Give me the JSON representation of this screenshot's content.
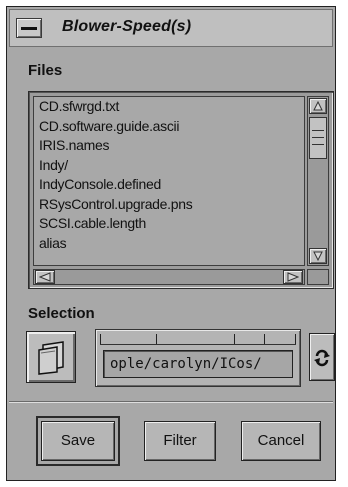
{
  "window": {
    "title": "Blower-Speed(s)"
  },
  "files": {
    "label": "Files",
    "items": [
      "CD.sfwrgd.txt",
      "CD.software.guide.ascii",
      "IRIS.names",
      "Indy/",
      "IndyConsole.defined",
      "RSysControl.upgrade.pns",
      "SCSI.cable.length",
      "alias"
    ]
  },
  "selection": {
    "label": "Selection",
    "path": "ople/carolyn/ICos/"
  },
  "buttons": {
    "save": "Save",
    "filter": "Filter",
    "cancel": "Cancel"
  },
  "icons": {
    "window_menu": "window-menu-icon",
    "folder": "folder-icon",
    "cycle": "cycle-arrows-icon",
    "up": "arrow-up-icon",
    "down": "arrow-down-icon",
    "left": "arrow-left-icon",
    "right": "arrow-right-icon"
  }
}
